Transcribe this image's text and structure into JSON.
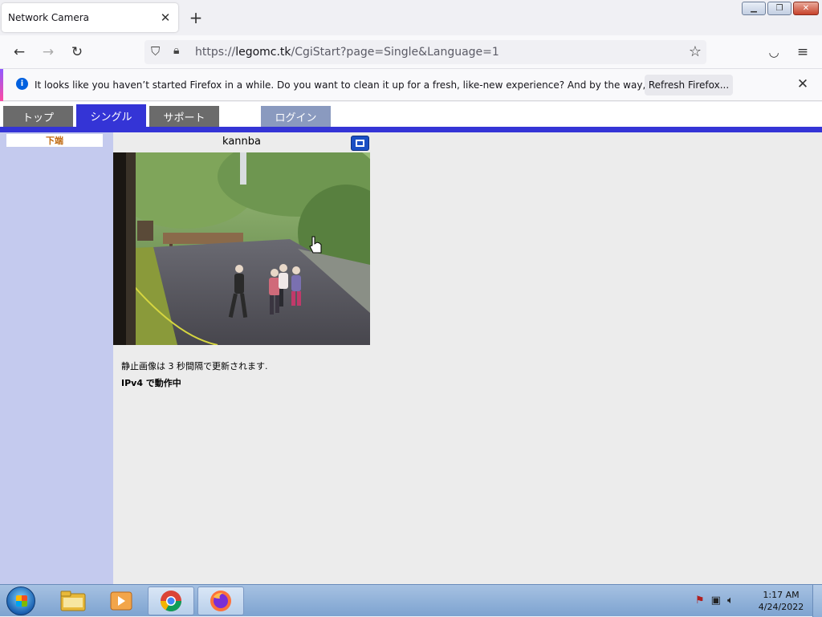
{
  "browser": {
    "tab": {
      "title": "Network Camera"
    },
    "url": {
      "host": "legomc.tk",
      "path": "/CgiStart?page=Single&Language=1",
      "scheme": "https://"
    },
    "notification": {
      "text": "It looks like you haven’t started Firefox in a while. Do you want to clean it up for a fresh, like-new experience? And by the way, welcome back!",
      "button": "Refresh Firefox..."
    }
  },
  "page": {
    "nav": [
      {
        "label": "トップ",
        "color": "#6b6b6b"
      },
      {
        "label": "シングル",
        "color": "#3434d6"
      },
      {
        "label": "サポート",
        "color": "#6b6b6b"
      },
      {
        "label": "ログイン",
        "color": "#8a9abf"
      }
    ],
    "sidebar": {
      "item": "下端"
    },
    "camera": {
      "title": "kannba",
      "status": "静止画像は 3 秒間隔で更新されます.",
      "protocol": "IPv4 で動作中"
    }
  },
  "taskbar": {
    "clock": {
      "time": "1:17 AM",
      "date": "4/24/2022"
    }
  },
  "colors": {
    "accent_bar": "#3434d6",
    "sidebar_bg": "#c4caee"
  }
}
